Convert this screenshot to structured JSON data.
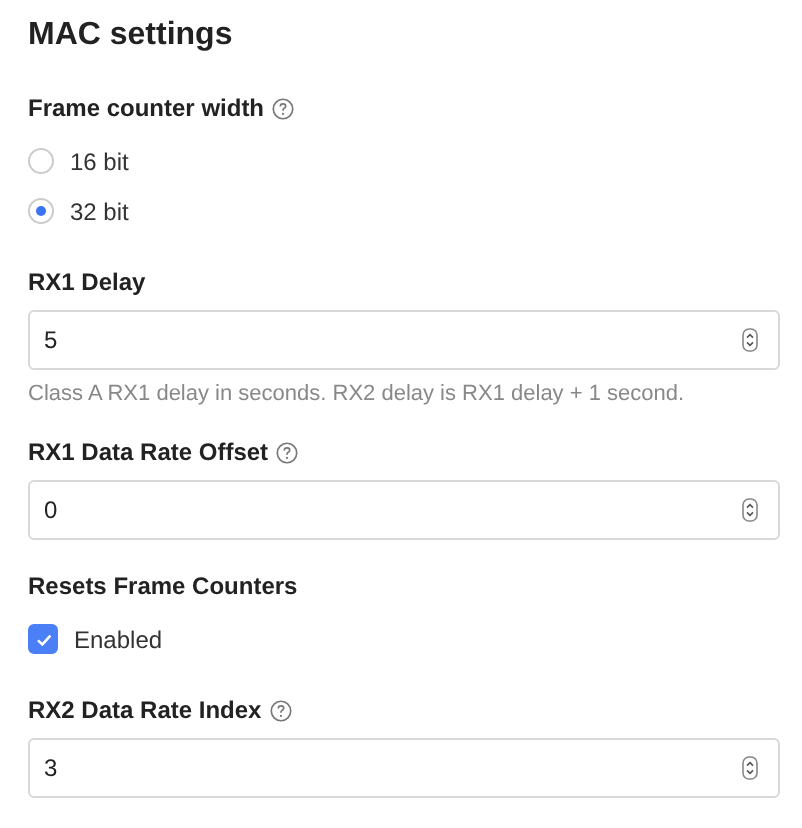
{
  "title": "MAC settings",
  "fields": [
    {
      "kind": "radio",
      "label": "Frame counter width",
      "help": true,
      "options": [
        {
          "label": "16 bit",
          "selected": false
        },
        {
          "label": "32 bit",
          "selected": true
        }
      ]
    },
    {
      "kind": "number",
      "label": "RX1 Delay",
      "help": false,
      "value": "5",
      "hint": "Class A RX1 delay in seconds. RX2 delay is RX1 delay + 1 second."
    },
    {
      "kind": "number",
      "label": "RX1 Data Rate Offset",
      "help": true,
      "value": "0"
    },
    {
      "kind": "checkbox",
      "label": "Resets Frame Counters",
      "help": false,
      "option": "Enabled",
      "checked": true
    },
    {
      "kind": "number",
      "label": "RX2 Data Rate Index",
      "help": true,
      "value": "3"
    }
  ]
}
